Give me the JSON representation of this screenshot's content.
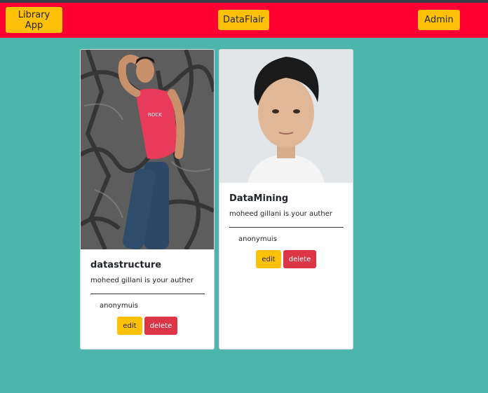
{
  "navbar": {
    "brand_label": "Library App",
    "center_label": "DataFlair",
    "admin_label": "Admin"
  },
  "books": [
    {
      "title": "datastructure",
      "text": "moheed gillani is your auther",
      "meta": "anonymuis",
      "edit_label": "edit",
      "delete_label": "delete"
    },
    {
      "title": "DataMining",
      "text": "moheed gillani is your auther",
      "meta": "anonymuis",
      "edit_label": "edit",
      "delete_label": "delete"
    }
  ],
  "colors": {
    "page_background": "#4db6ac",
    "navbar": "#ff0033",
    "warning": "#ffc107",
    "danger": "#dc3545"
  }
}
